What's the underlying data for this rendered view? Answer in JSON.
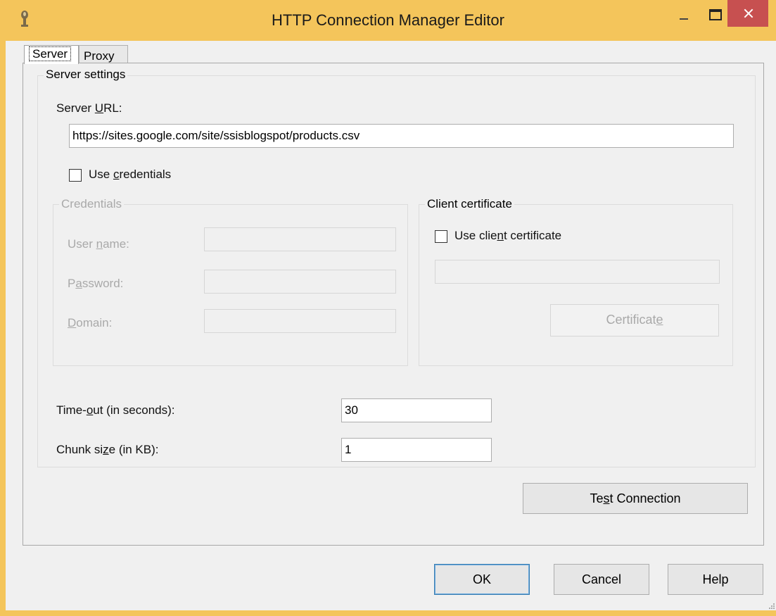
{
  "window": {
    "title": "HTTP Connection Manager Editor"
  },
  "tabs": [
    {
      "label": "Server",
      "selected": true
    },
    {
      "label": "Proxy",
      "selected": false
    }
  ],
  "server_settings": {
    "title": "Server settings",
    "url_label_pre": "Server ",
    "url_label_ul": "U",
    "url_label_post": "RL:",
    "url_value": "https://sites.google.com/site/ssisblogspot/products.csv",
    "use_credentials_pre": "Use ",
    "use_credentials_ul": "c",
    "use_credentials_post": "redentials",
    "use_credentials_checked": false
  },
  "credentials": {
    "title": "Credentials",
    "username_pre": "User ",
    "username_ul": "n",
    "username_post": "ame:",
    "password_pre": "P",
    "password_ul": "a",
    "password_post": "ssword:",
    "domain_ul": "D",
    "domain_post": "omain:",
    "username_value": "",
    "password_value": "",
    "domain_value": ""
  },
  "client_certificate": {
    "title": "Client certificate",
    "use_cert_pre": "Use clie",
    "use_cert_ul": "n",
    "use_cert_post": "t certificate",
    "use_cert_checked": false,
    "cert_value": "",
    "cert_btn_pre": "Certificat",
    "cert_btn_ul": "e",
    "cert_btn_post": ""
  },
  "timeout": {
    "label_pre": "Time-",
    "label_ul": "o",
    "label_post": "ut (in seconds):",
    "value": "30"
  },
  "chunk": {
    "label_pre": "Chunk si",
    "label_ul": "z",
    "label_post": "e (in KB):",
    "value": "1"
  },
  "test_connection": {
    "pre": "Te",
    "ul": "s",
    "post": "t Connection"
  },
  "footer": {
    "ok": "OK",
    "cancel": "Cancel",
    "help": "Help"
  },
  "colors": {
    "title_bar": "#f4c55b",
    "close": "#c75050",
    "dialog_bg": "#f0f0f0"
  }
}
